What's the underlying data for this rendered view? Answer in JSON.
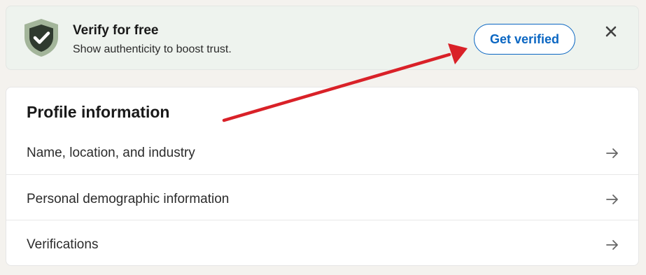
{
  "banner": {
    "title": "Verify for free",
    "subtitle": "Show authenticity to boost trust.",
    "cta_label": "Get verified",
    "icon": "shield-check-icon",
    "close_icon": "close-icon"
  },
  "profile": {
    "title": "Profile information",
    "items": [
      {
        "label": "Name, location, and industry",
        "icon": "arrow-right-icon"
      },
      {
        "label": "Personal demographic information",
        "icon": "arrow-right-icon"
      },
      {
        "label": "Verifications",
        "icon": "arrow-right-icon"
      }
    ]
  },
  "annotation": {
    "type": "red-arrow",
    "target": "verify-button"
  },
  "colors": {
    "accent": "#0a66c2",
    "banner_bg": "#eef3ee",
    "shield": "#a3b59a",
    "arrow": "#d92128",
    "page_bg": "#f4f2ee"
  }
}
